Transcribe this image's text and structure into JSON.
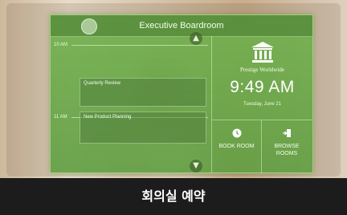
{
  "room": {
    "title": "Executive Boardroom"
  },
  "schedule": {
    "times": [
      "10 AM",
      "11 AM"
    ],
    "meetings": [
      "Quarterly Review",
      "New Product Planning"
    ]
  },
  "info": {
    "company": "Prestige Worldwide",
    "time": "9:49 AM",
    "date": "Tuesday, June 21"
  },
  "actions": {
    "book": "BOOK ROOM",
    "browse": "BROWSE ROOMS"
  },
  "caption": "회의실 예약",
  "icons": {
    "logo": "logo-circle-icon",
    "building": "building-icon",
    "book": "clock-icon",
    "browse": "door-arrow-icon",
    "up": "chevron-up-icon",
    "down": "chevron-down-icon"
  },
  "colors": {
    "panel": "#6fb24c",
    "caption_bg": "#1c1c1c"
  }
}
